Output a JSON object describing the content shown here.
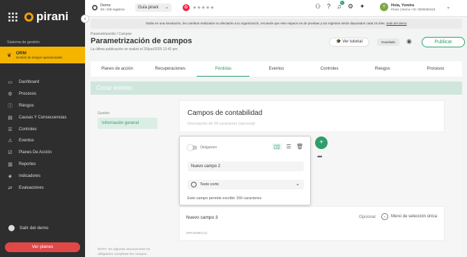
{
  "brand": {
    "name": "pirani"
  },
  "sidebar": {
    "section_label": "Sistema de gestión",
    "system": {
      "code": "ORM",
      "desc": "Gestión de riesgos operacionales"
    },
    "items": [
      {
        "label": "Dashboard"
      },
      {
        "label": "Procesos"
      },
      {
        "label": "Riesgos"
      },
      {
        "label": "Causas Y Consecuencias"
      },
      {
        "label": "Controles"
      },
      {
        "label": "Eventos"
      },
      {
        "label": "Planes De Acción"
      },
      {
        "label": "Reportes"
      },
      {
        "label": "Indicadores"
      },
      {
        "label": "Evaluaciones"
      }
    ],
    "exit_demo": "Salir del demo",
    "plans_button": "Ver planes"
  },
  "topbar": {
    "demo_label": "Demo",
    "demo_count": "29 / 100 registros",
    "guide": "Guía pirani",
    "bell_count": "1",
    "user_greet": "Hola, Yomira",
    "user_org": "Pirani | Demo • ID: 0000000419",
    "avatar": "Y"
  },
  "banner": {
    "text": "Estás en una simulación, los cambios realizados no afectarán a tu organización, recuerde que este espacio es de pruebas y tus registros serán depurados cada 15 días.",
    "link": "Salir del demo"
  },
  "page": {
    "breadcrumb": "Parametrización / Campos",
    "title": "Parametrización de campos",
    "published": "La última publicación se realizó el 20/jun/2025 12:42 pm",
    "tutorial": "Ver tutorial",
    "saved": "Guardado",
    "publish": "Publicar"
  },
  "tabs": [
    "Planes de acción",
    "Recuperaciones",
    "Pérdidas",
    "Eventos",
    "Controles",
    "Riesgos",
    "Procesos"
  ],
  "create_label": "Crear evento",
  "left_menu": {
    "section": "Gestión",
    "item": "Información general",
    "note": "NOTA: En algunas asociaciones es obligatorio completar los campos."
  },
  "section_card": {
    "title": "Campos de contabilidad",
    "desc": "Descripción de 50 caracteres (opcional)"
  },
  "editor": {
    "required_label": "Obligatorio",
    "name_value": "Nuevo campo 2",
    "type": "Texto corto",
    "help": "Este campo permite escribir 150 caracteres"
  },
  "field3": {
    "name": "Nuevo campo 3",
    "optional": "Opcional",
    "type": "Menú de selección única",
    "options_label": "OPCIONES (1)"
  }
}
